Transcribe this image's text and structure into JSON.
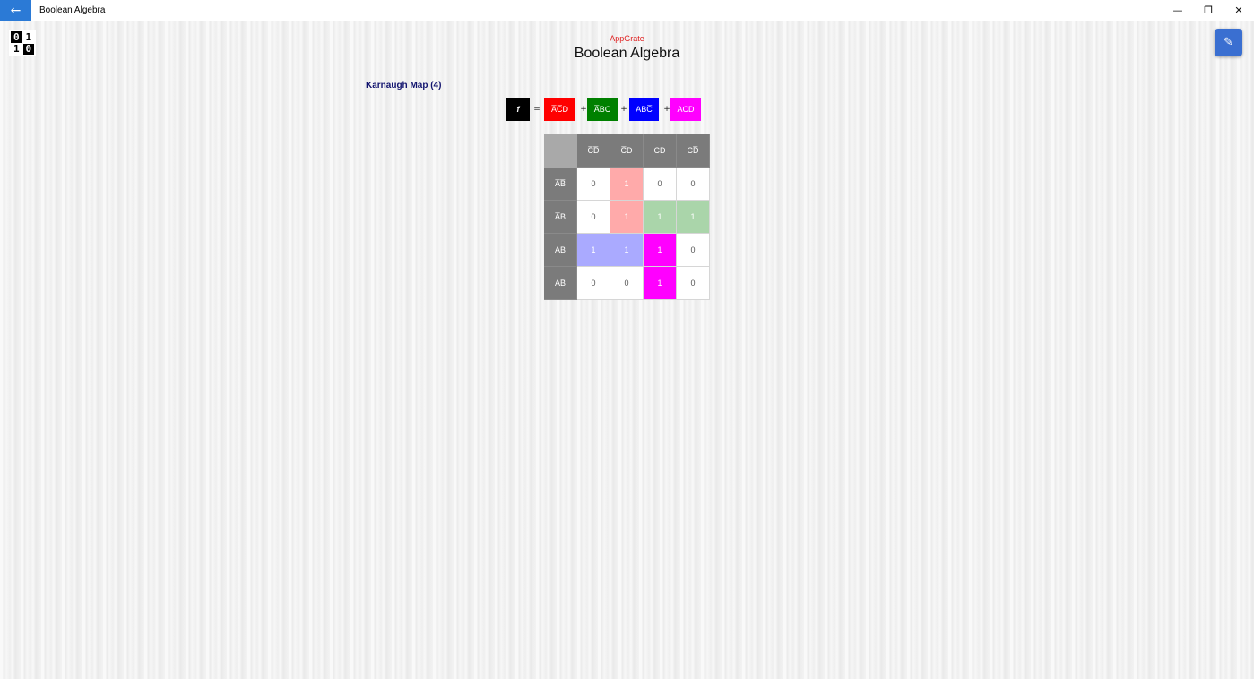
{
  "window": {
    "title": "Boolean Algebra",
    "back_icon": "←",
    "minimize_icon": "—",
    "restore_icon": "❐",
    "close_icon": "✕"
  },
  "logo": {
    "cells": [
      "0",
      "1",
      "1",
      "0"
    ]
  },
  "header": {
    "brand": "AppGrate",
    "title": "Boolean Algebra",
    "edit_icon": "✎"
  },
  "section": {
    "title": "Karnaugh Map (4)"
  },
  "expression": {
    "function_label": "f",
    "equals": "=",
    "plus": "+",
    "terms": [
      {
        "display": "A̅C̅D",
        "color": "#ff0000"
      },
      {
        "display": "A̅BC",
        "color": "#008000"
      },
      {
        "display": "ABC̅",
        "color": "#0000ff"
      },
      {
        "display": "ACD",
        "color": "#ff00ff"
      }
    ]
  },
  "kmap": {
    "col_headers": [
      "C̅D̅",
      "C̅D",
      "CD",
      "CD̅"
    ],
    "row_headers": [
      "A̅B̅",
      "A̅B",
      "AB",
      "AB̅"
    ],
    "values": [
      [
        "0",
        "1",
        "0",
        "0"
      ],
      [
        "0",
        "1",
        "1",
        "1"
      ],
      [
        "1",
        "1",
        "1",
        "0"
      ],
      [
        "0",
        "0",
        "1",
        "0"
      ]
    ],
    "cell_colors": [
      [
        "",
        "#ffaaaa",
        "",
        ""
      ],
      [
        "",
        "#ffaaaa",
        "#aad5aa",
        "#aad5aa"
      ],
      [
        "#aaaaff",
        "#aaaaff",
        "#ff00ff",
        ""
      ],
      [
        "",
        "",
        "#ff00ff",
        ""
      ]
    ]
  }
}
